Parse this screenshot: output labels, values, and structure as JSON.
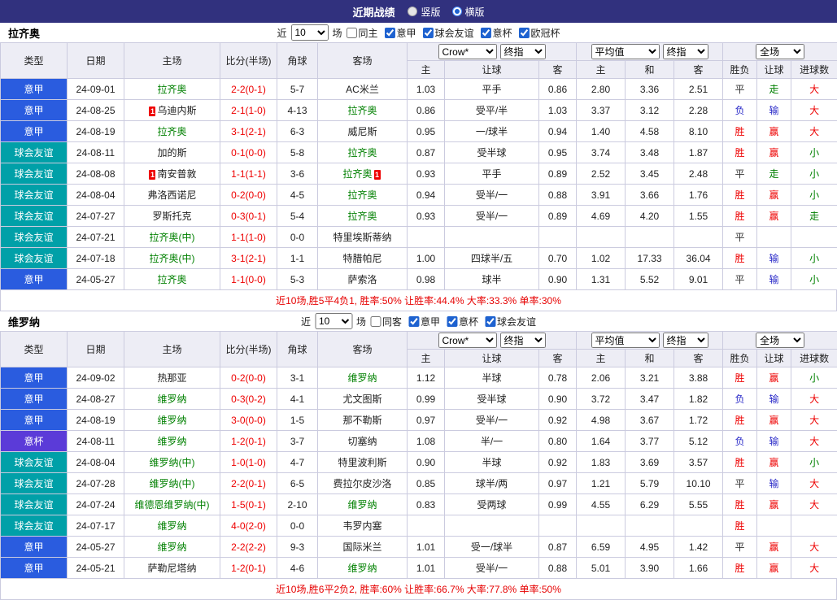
{
  "topbar": {
    "title": "近期战绩",
    "radios": [
      {
        "label": "竖版",
        "selected": false
      },
      {
        "label": "横版",
        "selected": true
      }
    ]
  },
  "filter_labels": {
    "near": "近",
    "matches": "场"
  },
  "table_header": {
    "type": "类型",
    "date": "日期",
    "home": "主场",
    "score": "比分(半场)",
    "corner": "角球",
    "away": "客场",
    "dd_crown": "Crow*",
    "dd_final1": "终指",
    "dd_avg": "平均值",
    "dd_final2": "终指",
    "dd_full": "全场",
    "odds_home": "主",
    "odds_hcap": "让球",
    "odds_away": "客",
    "avg_home": "主",
    "avg_draw": "和",
    "avg_away": "客",
    "res": "胜负",
    "res_hcap": "让球",
    "res_goal": "进球数"
  },
  "type_colors": {
    "意甲": "#2a5cdf",
    "球会友谊": "#00a0a8",
    "意杯": "#5b3bd8",
    "欧冠杯": "#2a5cdf"
  },
  "result_colors": {
    "胜": "#ee0000",
    "负": "#2929c8",
    "平": "#333333"
  },
  "hcap_result_colors": {
    "赢": "#ee0000",
    "输": "#2929c8",
    "走": "#008000"
  },
  "goal_colors": {
    "大": "#ee0000",
    "小": "#008000",
    "走": "#008000"
  },
  "sections": [
    {
      "team": "拉齐奥",
      "filter": {
        "count": "10",
        "checkboxes": [
          {
            "label": "同主",
            "checked": false,
            "name": "same-home"
          },
          {
            "label": "意甲",
            "checked": true,
            "name": "serie-a"
          },
          {
            "label": "球会友谊",
            "checked": true,
            "name": "club-friendly"
          },
          {
            "label": "意杯",
            "checked": true,
            "name": "coppa-italia"
          },
          {
            "label": "欧冠杯",
            "checked": true,
            "name": "champions-league"
          }
        ]
      },
      "rows": [
        {
          "type": "意甲",
          "date": "24-09-01",
          "home": "拉齐奥",
          "home_green": true,
          "home_card": "",
          "score": "2-2(0-1)",
          "corner": "5-7",
          "away": "AC米兰",
          "away_green": false,
          "away_card": "",
          "w1": "1.03",
          "hcap": "平手",
          "w2": "0.86",
          "avg1": "2.80",
          "avgx": "3.36",
          "avg2": "2.51",
          "res": "平",
          "hres": "走",
          "goal": "大"
        },
        {
          "type": "意甲",
          "date": "24-08-25",
          "home": "乌迪内斯",
          "home_green": false,
          "home_card": "1",
          "score": "2-1(1-0)",
          "corner": "4-13",
          "away": "拉齐奥",
          "away_green": true,
          "away_card": "",
          "w1": "0.86",
          "hcap": "受平/半",
          "w2": "1.03",
          "avg1": "3.37",
          "avgx": "3.12",
          "avg2": "2.28",
          "res": "负",
          "hres": "输",
          "goal": "大"
        },
        {
          "type": "意甲",
          "date": "24-08-19",
          "home": "拉齐奥",
          "home_green": true,
          "home_card": "",
          "score": "3-1(2-1)",
          "corner": "6-3",
          "away": "威尼斯",
          "away_green": false,
          "away_card": "",
          "w1": "0.95",
          "hcap": "一/球半",
          "w2": "0.94",
          "avg1": "1.40",
          "avgx": "4.58",
          "avg2": "8.10",
          "res": "胜",
          "hres": "赢",
          "goal": "大"
        },
        {
          "type": "球会友谊",
          "date": "24-08-11",
          "home": "加的斯",
          "home_green": false,
          "home_card": "",
          "score": "0-1(0-0)",
          "corner": "5-8",
          "away": "拉齐奥",
          "away_green": true,
          "away_card": "",
          "w1": "0.87",
          "hcap": "受半球",
          "w2": "0.95",
          "avg1": "3.74",
          "avgx": "3.48",
          "avg2": "1.87",
          "res": "胜",
          "hres": "赢",
          "goal": "小"
        },
        {
          "type": "球会友谊",
          "date": "24-08-08",
          "home": "南安普敦",
          "home_green": false,
          "home_card": "1",
          "score": "1-1(1-1)",
          "corner": "3-6",
          "away": "拉齐奥",
          "away_green": true,
          "away_card": "1",
          "w1": "0.93",
          "hcap": "平手",
          "w2": "0.89",
          "avg1": "2.52",
          "avgx": "3.45",
          "avg2": "2.48",
          "res": "平",
          "hres": "走",
          "goal": "小"
        },
        {
          "type": "球会友谊",
          "date": "24-08-04",
          "home": "弗洛西诺尼",
          "home_green": false,
          "home_card": "",
          "score": "0-2(0-0)",
          "corner": "4-5",
          "away": "拉齐奥",
          "away_green": true,
          "away_card": "",
          "w1": "0.94",
          "hcap": "受半/一",
          "w2": "0.88",
          "avg1": "3.91",
          "avgx": "3.66",
          "avg2": "1.76",
          "res": "胜",
          "hres": "赢",
          "goal": "小"
        },
        {
          "type": "球会友谊",
          "date": "24-07-27",
          "home": "罗斯托克",
          "home_green": false,
          "home_card": "",
          "score": "0-3(0-1)",
          "corner": "5-4",
          "away": "拉齐奥",
          "away_green": true,
          "away_card": "",
          "w1": "0.93",
          "hcap": "受半/一",
          "w2": "0.89",
          "avg1": "4.69",
          "avgx": "4.20",
          "avg2": "1.55",
          "res": "胜",
          "hres": "赢",
          "goal": "走"
        },
        {
          "type": "球会友谊",
          "date": "24-07-21",
          "home": "拉齐奥(中)",
          "home_green": true,
          "home_card": "",
          "score": "1-1(1-0)",
          "corner": "0-0",
          "away": "特里埃斯蒂纳",
          "away_green": false,
          "away_card": "",
          "w1": "",
          "hcap": "",
          "w2": "",
          "avg1": "",
          "avgx": "",
          "avg2": "",
          "res": "平",
          "hres": "",
          "goal": ""
        },
        {
          "type": "球会友谊",
          "date": "24-07-18",
          "home": "拉齐奥(中)",
          "home_green": true,
          "home_card": "",
          "score": "3-1(2-1)",
          "corner": "1-1",
          "away": "特腊帕尼",
          "away_green": false,
          "away_card": "",
          "w1": "1.00",
          "hcap": "四球半/五",
          "w2": "0.70",
          "avg1": "1.02",
          "avgx": "17.33",
          "avg2": "36.04",
          "res": "胜",
          "hres": "输",
          "goal": "小"
        },
        {
          "type": "意甲",
          "date": "24-05-27",
          "home": "拉齐奥",
          "home_green": true,
          "home_card": "",
          "score": "1-1(0-0)",
          "corner": "5-3",
          "away": "萨索洛",
          "away_green": false,
          "away_card": "",
          "w1": "0.98",
          "hcap": "球半",
          "w2": "0.90",
          "avg1": "1.31",
          "avgx": "5.52",
          "avg2": "9.01",
          "res": "平",
          "hres": "输",
          "goal": "小"
        }
      ],
      "summary": "近10场,胜5平4负1, 胜率:50% 让胜率:44.4% 大率:33.3% 单率:30%"
    },
    {
      "team": "维罗纳",
      "filter": {
        "count": "10",
        "checkboxes": [
          {
            "label": "同客",
            "checked": false,
            "name": "same-away"
          },
          {
            "label": "意甲",
            "checked": true,
            "name": "serie-a"
          },
          {
            "label": "意杯",
            "checked": true,
            "name": "coppa-italia"
          },
          {
            "label": "球会友谊",
            "checked": true,
            "name": "club-friendly"
          }
        ]
      },
      "rows": [
        {
          "type": "意甲",
          "date": "24-09-02",
          "home": "热那亚",
          "home_green": false,
          "home_card": "",
          "score": "0-2(0-0)",
          "corner": "3-1",
          "away": "维罗纳",
          "away_green": true,
          "away_card": "",
          "w1": "1.12",
          "hcap": "半球",
          "w2": "0.78",
          "avg1": "2.06",
          "avgx": "3.21",
          "avg2": "3.88",
          "res": "胜",
          "hres": "赢",
          "goal": "小"
        },
        {
          "type": "意甲",
          "date": "24-08-27",
          "home": "维罗纳",
          "home_green": true,
          "home_card": "",
          "score": "0-3(0-2)",
          "corner": "4-1",
          "away": "尤文图斯",
          "away_green": false,
          "away_card": "",
          "w1": "0.99",
          "hcap": "受半球",
          "w2": "0.90",
          "avg1": "3.72",
          "avgx": "3.47",
          "avg2": "1.82",
          "res": "负",
          "hres": "输",
          "goal": "大"
        },
        {
          "type": "意甲",
          "date": "24-08-19",
          "home": "维罗纳",
          "home_green": true,
          "home_card": "",
          "score": "3-0(0-0)",
          "corner": "1-5",
          "away": "那不勒斯",
          "away_green": false,
          "away_card": "",
          "w1": "0.97",
          "hcap": "受半/一",
          "w2": "0.92",
          "avg1": "4.98",
          "avgx": "3.67",
          "avg2": "1.72",
          "res": "胜",
          "hres": "赢",
          "goal": "大"
        },
        {
          "type": "意杯",
          "date": "24-08-11",
          "home": "维罗纳",
          "home_green": true,
          "home_card": "",
          "score": "1-2(0-1)",
          "corner": "3-7",
          "away": "切塞纳",
          "away_green": false,
          "away_card": "",
          "w1": "1.08",
          "hcap": "半/一",
          "w2": "0.80",
          "avg1": "1.64",
          "avgx": "3.77",
          "avg2": "5.12",
          "res": "负",
          "hres": "输",
          "goal": "大"
        },
        {
          "type": "球会友谊",
          "date": "24-08-04",
          "home": "维罗纳(中)",
          "home_green": true,
          "home_card": "",
          "score": "1-0(1-0)",
          "corner": "4-7",
          "away": "特里波利斯",
          "away_green": false,
          "away_card": "",
          "w1": "0.90",
          "hcap": "半球",
          "w2": "0.92",
          "avg1": "1.83",
          "avgx": "3.69",
          "avg2": "3.57",
          "res": "胜",
          "hres": "赢",
          "goal": "小"
        },
        {
          "type": "球会友谊",
          "date": "24-07-28",
          "home": "维罗纳(中)",
          "home_green": true,
          "home_card": "",
          "score": "2-2(0-1)",
          "corner": "6-5",
          "away": "费拉尔皮沙洛",
          "away_green": false,
          "away_card": "",
          "w1": "0.85",
          "hcap": "球半/两",
          "w2": "0.97",
          "avg1": "1.21",
          "avgx": "5.79",
          "avg2": "10.10",
          "res": "平",
          "hres": "输",
          "goal": "大"
        },
        {
          "type": "球会友谊",
          "date": "24-07-24",
          "home": "维德恩维罗纳(中)",
          "home_green": true,
          "home_card": "",
          "score": "1-5(0-1)",
          "corner": "2-10",
          "away": "维罗纳",
          "away_green": true,
          "away_card": "",
          "w1": "0.83",
          "hcap": "受两球",
          "w2": "0.99",
          "avg1": "4.55",
          "avgx": "6.29",
          "avg2": "5.55",
          "res": "胜",
          "hres": "赢",
          "goal": "大"
        },
        {
          "type": "球会友谊",
          "date": "24-07-17",
          "home": "维罗纳",
          "home_green": true,
          "home_card": "",
          "score": "4-0(2-0)",
          "corner": "0-0",
          "away": "韦罗内塞",
          "away_green": false,
          "away_card": "",
          "w1": "",
          "hcap": "",
          "w2": "",
          "avg1": "",
          "avgx": "",
          "avg2": "",
          "res": "胜",
          "hres": "",
          "goal": ""
        },
        {
          "type": "意甲",
          "date": "24-05-27",
          "home": "维罗纳",
          "home_green": true,
          "home_card": "",
          "score": "2-2(2-2)",
          "corner": "9-3",
          "away": "国际米兰",
          "away_green": false,
          "away_card": "",
          "w1": "1.01",
          "hcap": "受一/球半",
          "w2": "0.87",
          "avg1": "6.59",
          "avgx": "4.95",
          "avg2": "1.42",
          "res": "平",
          "hres": "赢",
          "goal": "大"
        },
        {
          "type": "意甲",
          "date": "24-05-21",
          "home": "萨勒尼塔纳",
          "home_green": false,
          "home_card": "",
          "score": "1-2(0-1)",
          "corner": "4-6",
          "away": "维罗纳",
          "away_green": true,
          "away_card": "",
          "w1": "1.01",
          "hcap": "受半/一",
          "w2": "0.88",
          "avg1": "5.01",
          "avgx": "3.90",
          "avg2": "1.66",
          "res": "胜",
          "hres": "赢",
          "goal": "大"
        }
      ],
      "summary": "近10场,胜6平2负2, 胜率:60% 让胜率:66.7% 大率:77.8% 单率:50%"
    }
  ]
}
